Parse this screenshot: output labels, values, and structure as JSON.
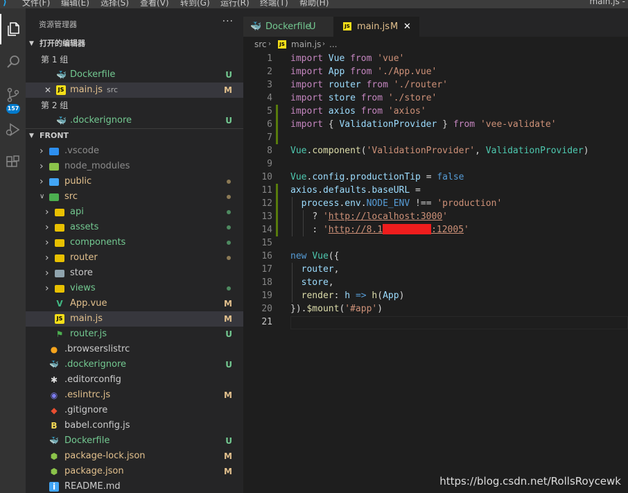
{
  "menubar": {
    "items": [
      "文件(F)",
      "编辑(E)",
      "选择(S)",
      "查看(V)",
      "转到(G)",
      "运行(R)",
      "终端(T)",
      "帮助(H)"
    ],
    "window_title": "main.js - "
  },
  "activity": {
    "scm_badge": "157"
  },
  "sidebar": {
    "title": "资源管理器",
    "open_editors_label": "打开的编辑器",
    "group1": "第 1 组",
    "group2": "第 2 组",
    "open_editors": [
      {
        "name": "Dockerfile",
        "status": "U",
        "icon": "docker-icon"
      },
      {
        "name": "main.js",
        "sub": "src",
        "status": "M",
        "icon": "js-icon"
      },
      {
        "name": ".dockerignore",
        "status": "U",
        "icon": "docker-icon"
      }
    ],
    "project_label": "FRONT",
    "tree": [
      {
        "name": ".vscode",
        "kind": "folder",
        "status": ""
      },
      {
        "name": "node_modules",
        "kind": "folder",
        "status": ""
      },
      {
        "name": "public",
        "kind": "folder",
        "status": "dot"
      },
      {
        "name": "src",
        "kind": "folder-open",
        "status": "dot"
      },
      {
        "name": "api",
        "kind": "folder",
        "status": "dot"
      },
      {
        "name": "assets",
        "kind": "folder",
        "status": "dot"
      },
      {
        "name": "components",
        "kind": "folder",
        "status": "dot"
      },
      {
        "name": "router",
        "kind": "folder",
        "status": "dot"
      },
      {
        "name": "store",
        "kind": "folder",
        "status": ""
      },
      {
        "name": "views",
        "kind": "folder",
        "status": "dot"
      },
      {
        "name": "App.vue",
        "kind": "vue",
        "status": "M"
      },
      {
        "name": "main.js",
        "kind": "js",
        "status": "M"
      },
      {
        "name": "router.js",
        "kind": "router",
        "status": "U"
      },
      {
        "name": ".browserslistrc",
        "kind": "browserslist",
        "status": ""
      },
      {
        "name": ".dockerignore",
        "kind": "docker",
        "status": "U"
      },
      {
        "name": ".editorconfig",
        "kind": "editorconfig",
        "status": ""
      },
      {
        "name": ".eslintrc.js",
        "kind": "eslint",
        "status": "M"
      },
      {
        "name": ".gitignore",
        "kind": "git",
        "status": ""
      },
      {
        "name": "babel.config.js",
        "kind": "babel",
        "status": ""
      },
      {
        "name": "Dockerfile",
        "kind": "docker",
        "status": "U"
      },
      {
        "name": "package-lock.json",
        "kind": "node",
        "status": "M"
      },
      {
        "name": "package.json",
        "kind": "node",
        "status": "M"
      },
      {
        "name": "README.md",
        "kind": "info",
        "status": ""
      }
    ]
  },
  "tabs": [
    {
      "name": "Dockerfile",
      "status": "U"
    },
    {
      "name": "main.js",
      "status": "M",
      "close": "✕"
    }
  ],
  "breadcrumb": {
    "folder": "src",
    "file": "main.js",
    "more": "..."
  },
  "code_lines": [
    "1",
    "2",
    "3",
    "4",
    "5",
    "6",
    "7",
    "8",
    "9",
    "10",
    "11",
    "12",
    "13",
    "14",
    "15",
    "16",
    "17",
    "18",
    "19",
    "20",
    "21"
  ],
  "code": {
    "l1": [
      "import",
      "Vue",
      "from",
      "'vue'"
    ],
    "l2": [
      "import",
      "App",
      "from",
      "'./App.vue'"
    ],
    "l3": [
      "import",
      "router",
      "from",
      "'./router'"
    ],
    "l4": [
      "import",
      "store",
      "from",
      "'./store'"
    ],
    "l5": [
      "import",
      "axios",
      "from",
      "'axios'"
    ],
    "l6": [
      "import",
      "{",
      "ValidationProvider",
      "}",
      "from",
      "'vee-validate'"
    ],
    "l8": [
      "Vue",
      ".",
      "component",
      "(",
      "'ValidationProvider'",
      ",",
      "ValidationProvider",
      ")"
    ],
    "l10": [
      "Vue",
      ".",
      "config",
      ".",
      "productionTip",
      "=",
      "false"
    ],
    "l11": [
      "axios",
      ".",
      "defaults",
      ".",
      "baseURL",
      "="
    ],
    "l12": [
      "process",
      ".",
      "env",
      ".",
      "NODE_ENV",
      "!==",
      "'production'"
    ],
    "l13": [
      "?",
      "'",
      "http://localhost:3000",
      "'"
    ],
    "l14": [
      ":",
      "'",
      "http://8.1",
      ":12005",
      "'"
    ],
    "l16": [
      "new",
      "Vue",
      "({"
    ],
    "l17": [
      "router",
      ","
    ],
    "l18": [
      "store",
      ","
    ],
    "l19": [
      "render",
      ":",
      "h",
      "=>",
      "h",
      "(",
      "App",
      ")"
    ],
    "l20": [
      "})",
      ".",
      "$mount",
      "(",
      "'#app'",
      ")"
    ]
  },
  "watermark": "https://blog.csdn.net/RollsRoycewk",
  "colors": {
    "modified": "#e2c08d",
    "untracked": "#73c991",
    "git_added": "#587c0c",
    "accent": "#007acc"
  }
}
